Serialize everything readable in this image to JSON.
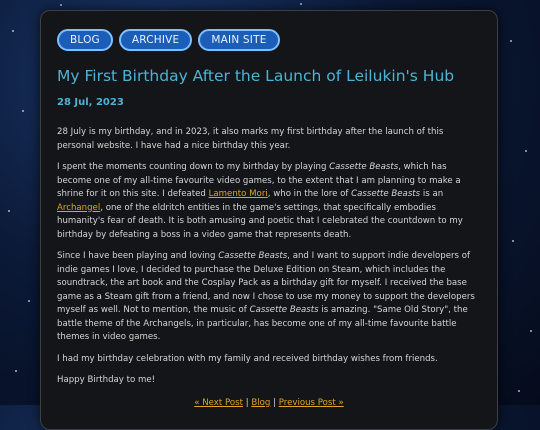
{
  "nav": {
    "blog": "BLOG",
    "archive": "ARCHIVE",
    "main_site": "MAIN SITE"
  },
  "post": {
    "title": "My First Birthday After the Launch of Leilukin's Hub",
    "date": "28 Jul, 2023",
    "p1": "28 July is my birthday, and in 2023, it also marks my first birthday after the launch of this personal website. I have had a nice birthday this year.",
    "p2": {
      "a": "I spent the moments counting down to my birthday by playing ",
      "game1": "Cassette Beasts",
      "b": ", which has become one of my all-time favourite video games, to the extent that I am planning to make a shrine for it on this site. I defeated ",
      "link1": "Lamento Mori",
      "c": ", who in the lore of ",
      "game2": "Cassette Beasts",
      "d": " is an ",
      "link2": "Archangel",
      "e": ", one of the eldritch entities in the game's settings, that specifically embodies humanity's fear of death. It is both amusing and poetic that I celebrated the countdown to my birthday by defeating a boss in a video game that represents death."
    },
    "p3": {
      "a": "Since I have been playing and loving ",
      "game1": "Cassette Beasts",
      "b": ", and I want to support indie developers of indie games I love, I decided to purchase the Deluxe Edition on Steam, which includes the soundtrack, the art book and the Cosplay Pack as a birthday gift for myself. I received the base game as a Steam gift from a friend, and now I chose to use my money to support the developers myself as well. Not to mention, the music of ",
      "game2": "Cassette Beasts",
      "c": " is amazing. \"Same Old Story\", the battle theme of the Archangels, in particular, has become one of my all-time favourite battle themes in video games."
    },
    "p4": "I had my birthday celebration with my family and received birthday wishes from friends.",
    "p5": "Happy Birthday to me!"
  },
  "footer_nav": {
    "next": "« Next Post",
    "sep1": " | ",
    "blog": "Blog",
    "sep2": " | ",
    "previous": "Previous Post »"
  }
}
